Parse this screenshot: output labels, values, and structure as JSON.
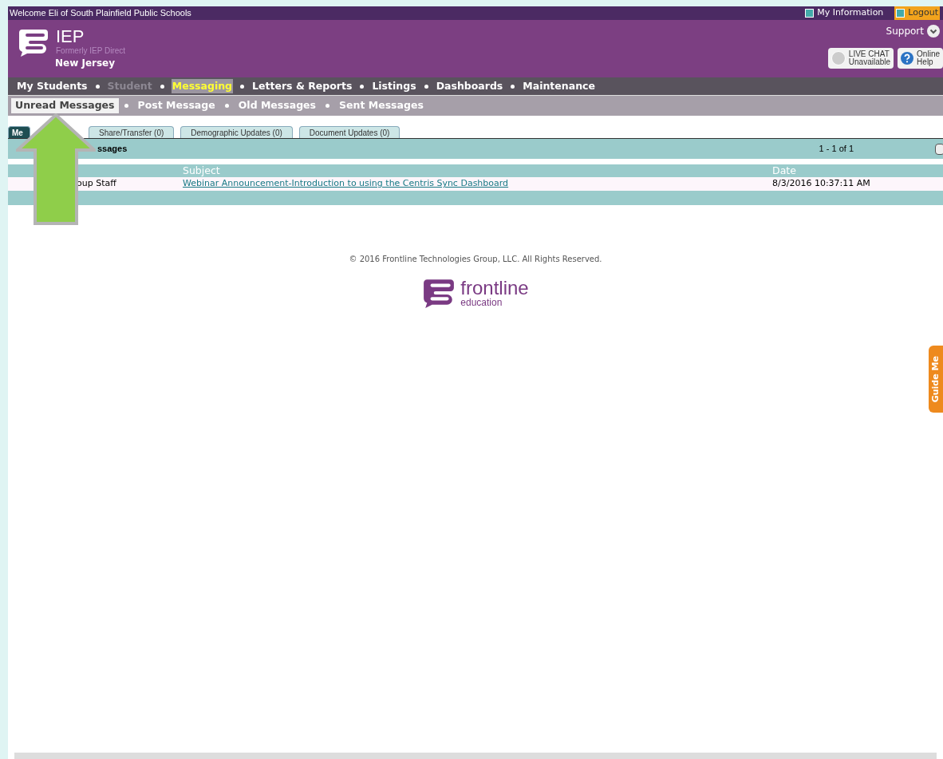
{
  "top_bar": {
    "welcome": "Welcome Eli of South Plainfield Public Schools",
    "links": [
      {
        "label": "My Information"
      },
      {
        "label": "Logout"
      }
    ]
  },
  "header": {
    "product": "IEP",
    "subtitle": "Formerly IEP Direct",
    "state": "New Jersey",
    "support": "Support",
    "live_chat": [
      "LIVE CHAT",
      "Unavailable"
    ],
    "help": [
      "Online",
      "Help"
    ]
  },
  "main_nav": [
    {
      "label": "My Students",
      "selected": false,
      "disabled": false
    },
    {
      "label": "Student",
      "selected": false,
      "disabled": true
    },
    {
      "label": "Messaging",
      "selected": true,
      "disabled": false
    },
    {
      "label": "Letters & Reports",
      "selected": false,
      "disabled": false
    },
    {
      "label": "Listings",
      "selected": false,
      "disabled": false
    },
    {
      "label": "Dashboards",
      "selected": false,
      "disabled": false
    },
    {
      "label": "Maintenance",
      "selected": false,
      "disabled": false
    }
  ],
  "sub_nav": [
    {
      "label": "Unread Messages",
      "selected": true
    },
    {
      "label": "Post Message",
      "selected": false
    },
    {
      "label": "Old Messages",
      "selected": false
    },
    {
      "label": "Sent Messages",
      "selected": false
    }
  ],
  "tabs": [
    {
      "label": "Me",
      "selected": true
    },
    {
      "label": "Share/Transfer (0)",
      "selected": false
    },
    {
      "label": "Demographic Updates (0)",
      "selected": false
    },
    {
      "label": "Document Updates (0)",
      "selected": false
    }
  ],
  "table": {
    "title": "ssages",
    "pager": "1 - 1 of 1",
    "columns": [
      "Subject",
      "Date"
    ],
    "rows": [
      {
        "sender": "oup Staff",
        "subject": "Webinar Announcement-Introduction to using the Centris Sync Dashboard",
        "date": "8/3/2016 10:37:11 AM"
      }
    ]
  },
  "footer": {
    "copyright": "© 2016 Frontline Technologies Group, LLC. All Rights Reserved.",
    "logo_name": "frontline",
    "logo_sub": "education"
  },
  "guide": "Guide Me"
}
